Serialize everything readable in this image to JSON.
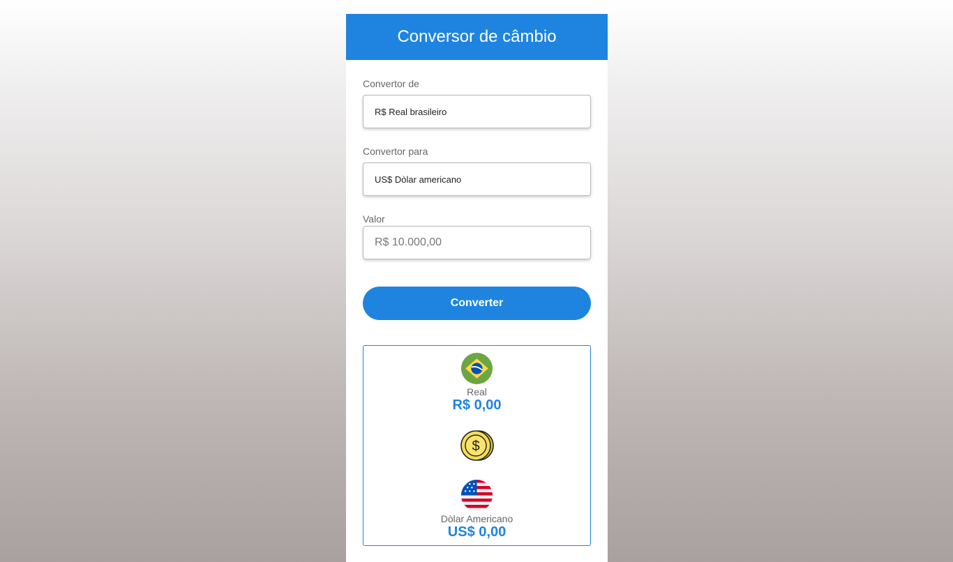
{
  "header": {
    "title": "Conversor de câmbio"
  },
  "form": {
    "from_label": "Convertor de",
    "from_value": "R$ Real brasileiro",
    "to_label": "Convertor para",
    "to_value": "US$ Dòlar americano",
    "amount_label": "Valor",
    "amount_placeholder": "R$ 10.000,00",
    "convert_button": "Converter"
  },
  "result": {
    "from": {
      "icon": "brazil-flag-icon",
      "name": "Real",
      "value": "R$ 0,00"
    },
    "exchange_icon": "dollar-coin-icon",
    "to": {
      "icon": "usa-flag-icon",
      "name": "Dòlar Americano",
      "value": "US$ 0,00"
    }
  },
  "colors": {
    "accent": "#1e84e0",
    "label": "#666666",
    "border": "#b8b8b8"
  }
}
